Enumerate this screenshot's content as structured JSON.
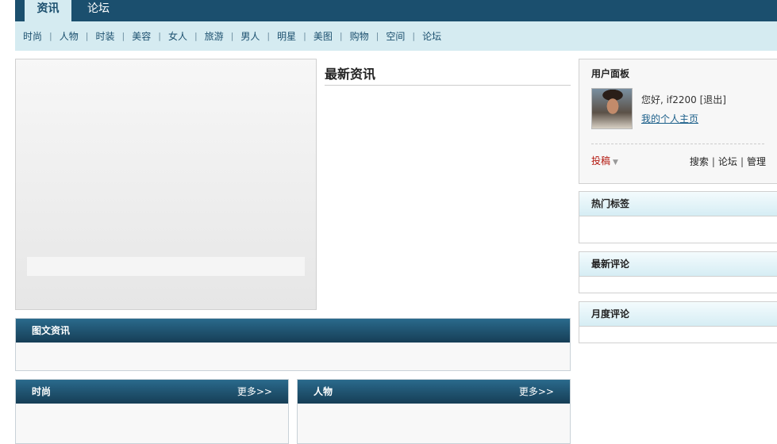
{
  "top_tabs": {
    "active": "资讯",
    "inactive": "论坛"
  },
  "subnav": [
    "时尚",
    "人物",
    "时装",
    "美容",
    "女人",
    "旅游",
    "男人",
    "明星",
    "美图",
    "购物",
    "空间",
    "论坛"
  ],
  "latest": {
    "title": "最新资讯"
  },
  "sections": {
    "photo_news": "图文资讯",
    "fashion": "时尚",
    "people": "人物",
    "more": "更多>>"
  },
  "user_panel": {
    "title": "用户面板",
    "greeting": "您好, if2200",
    "logout": "[退出]",
    "home_link": "我的个人主页",
    "submit": "投稿",
    "tools": [
      "搜索",
      "论坛",
      "管理"
    ]
  },
  "side_boxes": [
    "热门标签",
    "最新评论",
    "月度评论"
  ],
  "colors": {
    "dark_blue": "#1b4f6e",
    "light_blue": "#d5ebf1",
    "submit_red": "#b3170e"
  }
}
